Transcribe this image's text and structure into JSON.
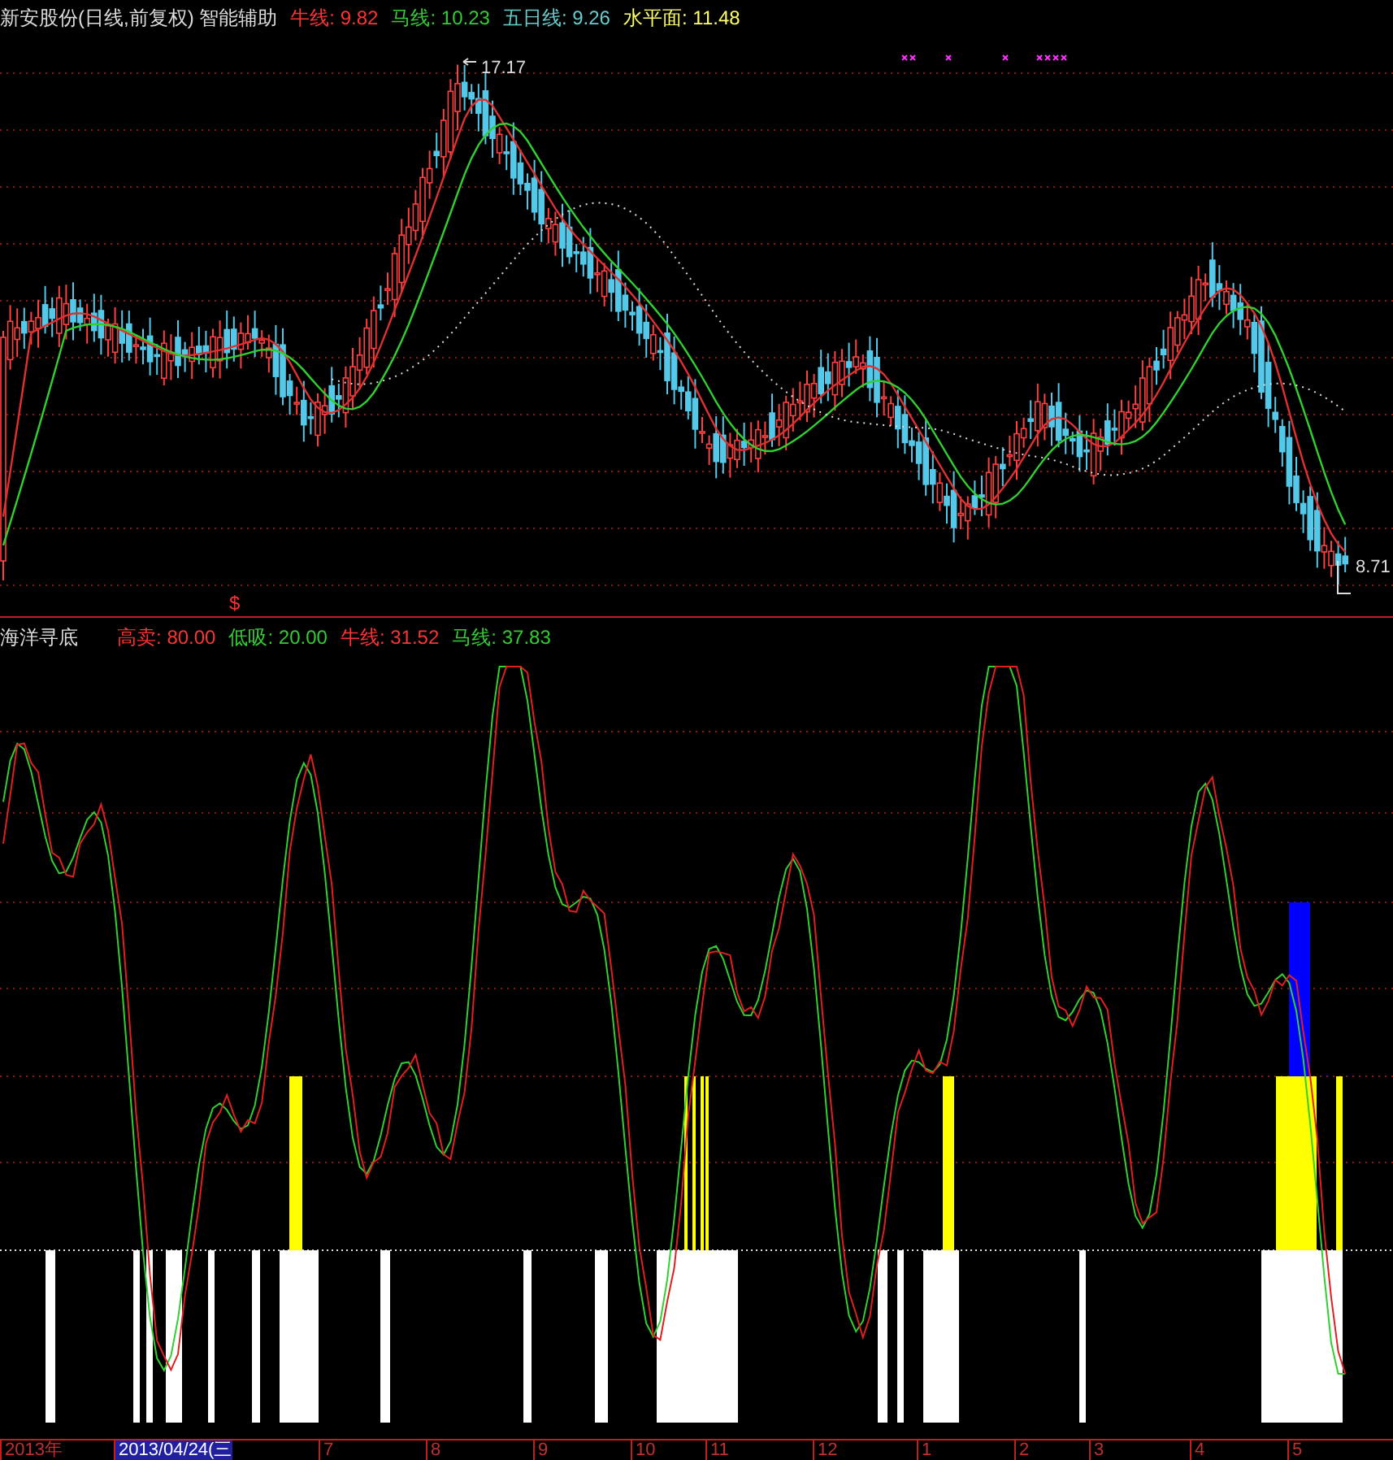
{
  "main_chart": {
    "title": "新安股份(日线,前复权) 智能辅助",
    "indicators": [
      {
        "label": "牛线:",
        "value": "9.82",
        "color": "#ff3333"
      },
      {
        "label": "马线:",
        "value": "10.23",
        "color": "#33cc33"
      },
      {
        "label": "五日线:",
        "value": "9.26",
        "color": "#66cccc"
      },
      {
        "label": "水平面:",
        "value": "11.48",
        "color": "#ffff66"
      }
    ],
    "high_label": "17.17",
    "low_label": "8.71",
    "signal_marker": "$"
  },
  "oscillator": {
    "title": "海洋寻底",
    "indicators": [
      {
        "label": "高卖:",
        "value": "80.00",
        "color": "#ff3333"
      },
      {
        "label": "低吸:",
        "value": "20.00",
        "color": "#33cc33"
      },
      {
        "label": "牛线:",
        "value": "31.52",
        "color": "#ff3333"
      },
      {
        "label": "马线:",
        "value": "37.83",
        "color": "#33cc33"
      }
    ]
  },
  "time_axis": {
    "labels": [
      {
        "text": "2013年",
        "selected": false
      },
      {
        "text": "2013/04/24(三",
        "selected": true
      },
      {
        "text": "7",
        "selected": false
      },
      {
        "text": "8",
        "selected": false
      },
      {
        "text": "9",
        "selected": false
      },
      {
        "text": "10",
        "selected": false
      },
      {
        "text": "11",
        "selected": false
      },
      {
        "text": "12",
        "selected": false
      },
      {
        "text": "1",
        "selected": false
      },
      {
        "text": "2",
        "selected": false
      },
      {
        "text": "3",
        "selected": false
      },
      {
        "text": "4",
        "selected": false
      },
      {
        "text": "5",
        "selected": false
      }
    ]
  }
}
